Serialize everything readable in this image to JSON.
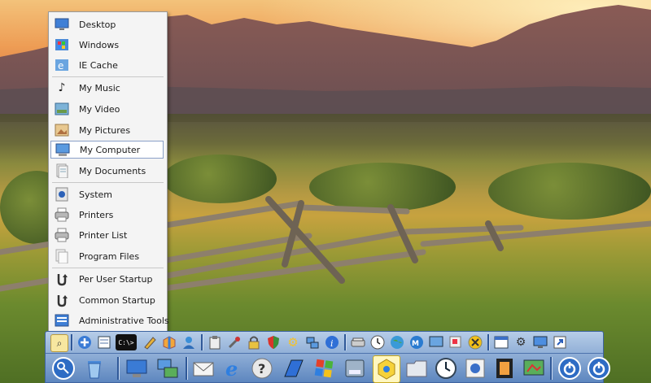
{
  "start_menu": {
    "items": [
      {
        "label": "Desktop",
        "icon": "desktop-icon"
      },
      {
        "label": "Windows",
        "icon": "windows-folder-icon"
      },
      {
        "label": "IE Cache",
        "icon": "ie-cache-icon"
      },
      {
        "label": "My Music",
        "icon": "music-note-icon"
      },
      {
        "label": "My Video",
        "icon": "video-icon"
      },
      {
        "label": "My Pictures",
        "icon": "pictures-icon"
      },
      {
        "label": "My Computer",
        "icon": "computer-icon"
      },
      {
        "label": "My Documents",
        "icon": "documents-icon"
      },
      {
        "label": "System",
        "icon": "system-icon"
      },
      {
        "label": "Printers",
        "icon": "printer-icon"
      },
      {
        "label": "Printer List",
        "icon": "printer-list-icon"
      },
      {
        "label": "Program Files",
        "icon": "program-files-icon"
      },
      {
        "label": "Per User Startup",
        "icon": "startup-arrow-icon"
      },
      {
        "label": "Common Startup",
        "icon": "startup-arrow-icon"
      },
      {
        "label": "Administrative Tools",
        "icon": "admin-tools-icon"
      }
    ],
    "selected": "My Computer"
  },
  "dock": {
    "row1_icons": [
      "search-icon",
      "add-icon",
      "notepad-icon",
      "command-prompt-icon",
      "pencil-icon",
      "package-icon",
      "user-icon",
      "clipboard-icon",
      "tools-icon",
      "lock-icon",
      "shield-icon",
      "gear-icon",
      "network-icon",
      "info-icon",
      "scanner-icon",
      "clock-icon",
      "globe-icon",
      "messenger-icon",
      "display-icon",
      "windows-icon",
      "close-circle-icon",
      "window-icon",
      "settings-icon",
      "monitor-icon",
      "shortcut-icon"
    ],
    "row2_icons": [
      "key-icon",
      "recycle-bin-icon",
      "desktop-monitor-icon",
      "computer-network-icon",
      "mail-icon",
      "internet-explorer-icon",
      "help-icon",
      "flag-icon",
      "windows-logo-icon",
      "disk-icon",
      "burn-icon",
      "folder-icon",
      "clock-icon",
      "media-icon",
      "film-icon",
      "paint-icon",
      "power-icon",
      "shutdown-icon"
    ]
  }
}
